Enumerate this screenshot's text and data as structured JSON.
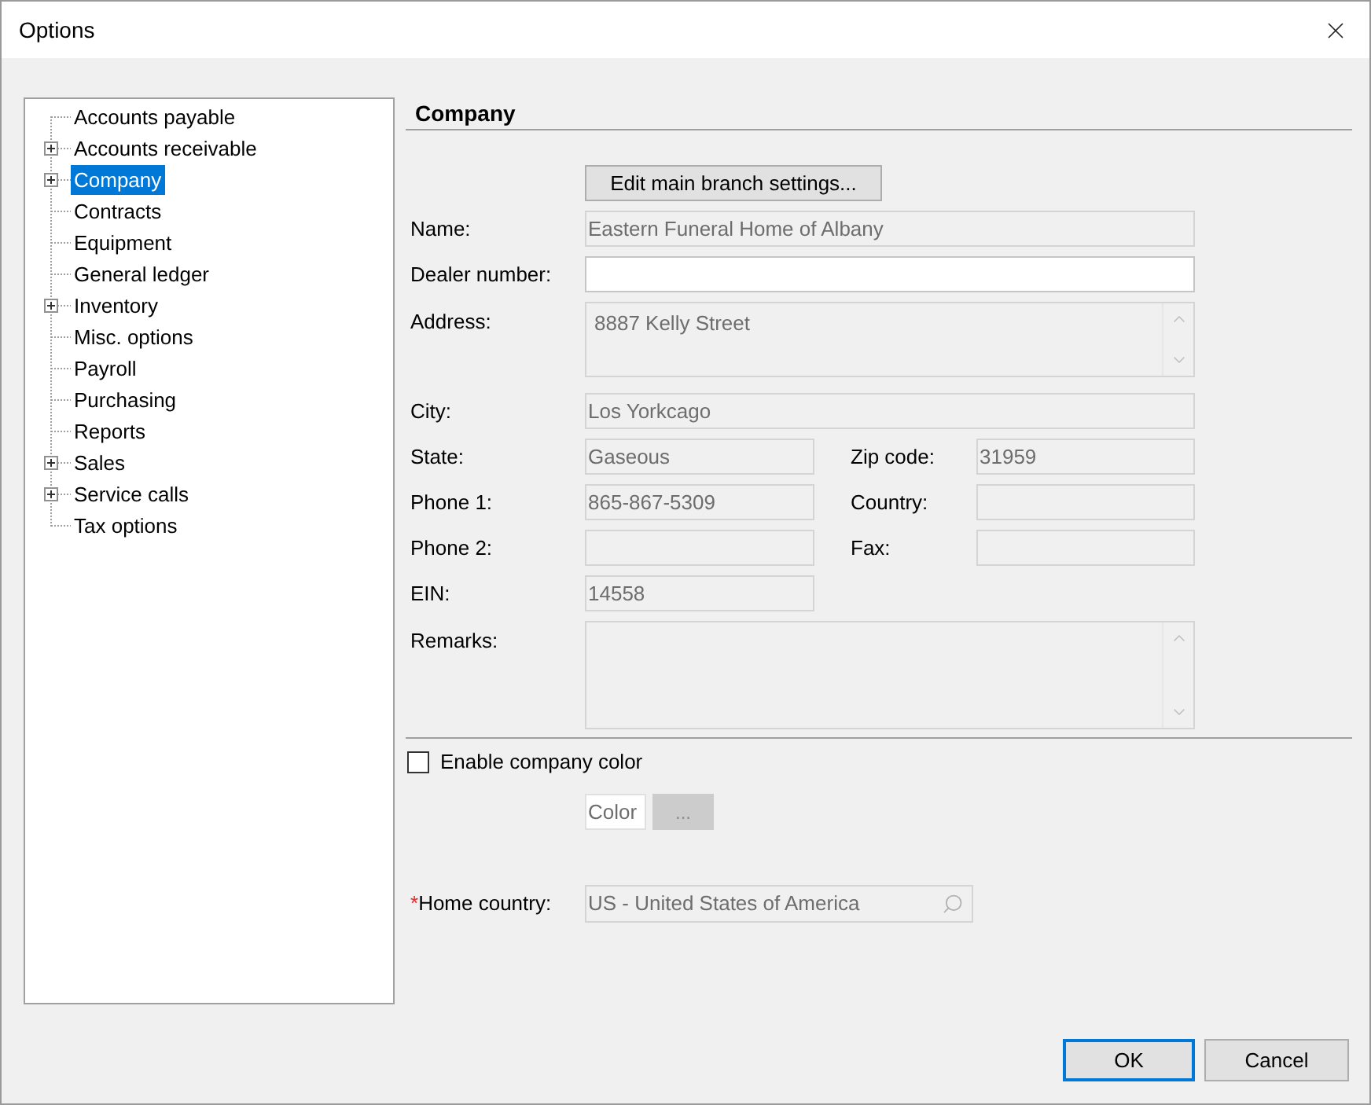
{
  "window": {
    "title": "Options"
  },
  "tree": {
    "items": [
      {
        "label": "Accounts payable",
        "expandable": false,
        "selected": false
      },
      {
        "label": "Accounts receivable",
        "expandable": true,
        "selected": false
      },
      {
        "label": "Company",
        "expandable": true,
        "selected": true
      },
      {
        "label": "Contracts",
        "expandable": false,
        "selected": false
      },
      {
        "label": "Equipment",
        "expandable": false,
        "selected": false
      },
      {
        "label": "General ledger",
        "expandable": false,
        "selected": false
      },
      {
        "label": "Inventory",
        "expandable": true,
        "selected": false
      },
      {
        "label": "Misc. options",
        "expandable": false,
        "selected": false
      },
      {
        "label": "Payroll",
        "expandable": false,
        "selected": false
      },
      {
        "label": "Purchasing",
        "expandable": false,
        "selected": false
      },
      {
        "label": "Reports",
        "expandable": false,
        "selected": false
      },
      {
        "label": "Sales",
        "expandable": true,
        "selected": false
      },
      {
        "label": "Service calls",
        "expandable": true,
        "selected": false
      },
      {
        "label": "Tax options",
        "expandable": false,
        "selected": false
      }
    ]
  },
  "panel": {
    "title": "Company",
    "edit_button": "Edit main branch settings...",
    "rows": [
      {
        "kind": "single",
        "fields": [
          {
            "label": "Name:",
            "value": "Eastern Funeral Home of Albany",
            "disabled": true
          }
        ]
      },
      {
        "kind": "single",
        "fields": [
          {
            "label": "Dealer number:",
            "disabled": false
          }
        ]
      },
      {
        "kind": "multiline",
        "fields": [
          {
            "label": "Address:",
            "value": "8887 Kelly Street",
            "disabled": true
          }
        ]
      },
      {
        "kind": "single",
        "fields": [
          {
            "label": "City:",
            "value": "Los Yorkcago",
            "disabled": true
          }
        ]
      },
      {
        "kind": "pair",
        "fields": [
          {
            "label": "State:",
            "value": "Gaseous",
            "disabled": true
          },
          {
            "label": "Zip code:",
            "value": "31959",
            "disabled": true
          }
        ]
      },
      {
        "kind": "pair",
        "fields": [
          {
            "label": "Phone 1:",
            "value": "865-867-5309",
            "disabled": true
          },
          {
            "label": "Country:",
            "disabled": true
          }
        ]
      },
      {
        "kind": "pair",
        "fields": [
          {
            "label": "Phone 2:",
            "disabled": true
          },
          {
            "label": "Fax:",
            "disabled": true
          }
        ]
      },
      {
        "kind": "short",
        "fields": [
          {
            "label": "EIN:",
            "value": "14558",
            "disabled": true
          }
        ]
      },
      {
        "kind": "memo",
        "fields": [
          {
            "label": "Remarks:",
            "disabled": true
          }
        ]
      }
    ],
    "company_color": {
      "label": "Enable company color",
      "checked": false,
      "swatch": "Color",
      "button": "...",
      "button_disabled": true
    },
    "home_country": {
      "required_mark": "*",
      "label": "Home country:",
      "value": "US - United States of America",
      "disabled": true
    }
  },
  "buttons": [
    {
      "label": "OK",
      "default": true
    },
    {
      "label": "Cancel",
      "default": false
    }
  ]
}
